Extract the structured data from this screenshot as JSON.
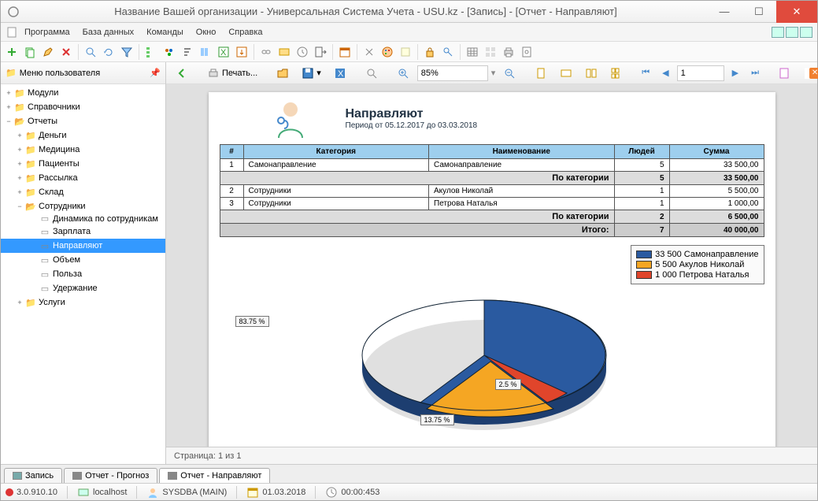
{
  "window": {
    "title": "Название Вашей организации - Универсальная Система Учета - USU.kz - [Запись] - [Отчет - Направляют]"
  },
  "menu": {
    "items": [
      "Программа",
      "База данных",
      "Команды",
      "Окно",
      "Справка"
    ]
  },
  "sidebar": {
    "title": "Меню пользователя",
    "nodes": [
      {
        "label": "Модули",
        "exp": "+",
        "lvl": 0,
        "type": "folder"
      },
      {
        "label": "Справочники",
        "exp": "+",
        "lvl": 0,
        "type": "folder"
      },
      {
        "label": "Отчеты",
        "exp": "−",
        "lvl": 0,
        "type": "folder-open"
      },
      {
        "label": "Деньги",
        "exp": "+",
        "lvl": 1,
        "type": "folder"
      },
      {
        "label": "Медицина",
        "exp": "+",
        "lvl": 1,
        "type": "folder"
      },
      {
        "label": "Пациенты",
        "exp": "+",
        "lvl": 1,
        "type": "folder"
      },
      {
        "label": "Рассылка",
        "exp": "+",
        "lvl": 1,
        "type": "folder"
      },
      {
        "label": "Склад",
        "exp": "+",
        "lvl": 1,
        "type": "folder"
      },
      {
        "label": "Сотрудники",
        "exp": "−",
        "lvl": 1,
        "type": "folder-open"
      },
      {
        "label": "Динамика по сотрудникам",
        "exp": "",
        "lvl": 2,
        "type": "file"
      },
      {
        "label": "Зарплата",
        "exp": "",
        "lvl": 2,
        "type": "file"
      },
      {
        "label": "Направляют",
        "exp": "",
        "lvl": 2,
        "type": "file",
        "selected": true
      },
      {
        "label": "Объем",
        "exp": "",
        "lvl": 2,
        "type": "file"
      },
      {
        "label": "Польза",
        "exp": "",
        "lvl": 2,
        "type": "file"
      },
      {
        "label": "Удержание",
        "exp": "",
        "lvl": 2,
        "type": "file"
      },
      {
        "label": "Услуги",
        "exp": "+",
        "lvl": 1,
        "type": "folder"
      }
    ]
  },
  "report_toolbar": {
    "print": "Печать...",
    "zoom": "85%",
    "page": "1",
    "close": "Закрыть"
  },
  "report": {
    "title": "Направляют",
    "period": "Период от 05.12.2017 до 03.03.2018",
    "headers": [
      "#",
      "Категория",
      "Наименование",
      "Людей",
      "Сумма"
    ],
    "rows": [
      {
        "n": "1",
        "cat": "Самонаправление",
        "name": "Самонаправление",
        "ppl": "5",
        "sum": "33 500,00"
      },
      {
        "subtotal": true,
        "label": "По категории",
        "ppl": "5",
        "sum": "33 500,00"
      },
      {
        "n": "2",
        "cat": "Сотрудники",
        "name": "Акулов Николай",
        "ppl": "1",
        "sum": "5 500,00"
      },
      {
        "n": "3",
        "cat": "Сотрудники",
        "name": "Петрова Наталья",
        "ppl": "1",
        "sum": "1 000,00"
      },
      {
        "subtotal": true,
        "label": "По категории",
        "ppl": "2",
        "sum": "6 500,00"
      },
      {
        "total": true,
        "label": "Итого:",
        "ppl": "7",
        "sum": "40 000,00"
      }
    ],
    "page_text": "Страница: 1 из 1"
  },
  "chart_data": {
    "type": "pie",
    "title": "",
    "series": [
      {
        "name": "33 500 Самонаправление",
        "value": 33500,
        "pct": 83.75,
        "color": "#2a5aa0"
      },
      {
        "name": "5 500 Акулов Николай",
        "value": 5500,
        "pct": 13.75,
        "color": "#f5a623"
      },
      {
        "name": "1 000 Петрова Наталья",
        "value": 1000,
        "pct": 2.5,
        "color": "#e0452b"
      }
    ],
    "labels": {
      "a": "83.75 %",
      "b": "13.75 %",
      "c": "2.5 %"
    }
  },
  "tabs": {
    "items": [
      {
        "label": "Запись",
        "active": false,
        "icon": "#7aa"
      },
      {
        "label": "Отчет - Прогноз",
        "active": false,
        "icon": "#888"
      },
      {
        "label": "Отчет - Направляют",
        "active": true,
        "icon": "#888"
      }
    ]
  },
  "status": {
    "version": "3.0.910.10",
    "host": "localhost",
    "user": "SYSDBA (MAIN)",
    "date": "01.03.2018",
    "time": "00:00:453"
  }
}
